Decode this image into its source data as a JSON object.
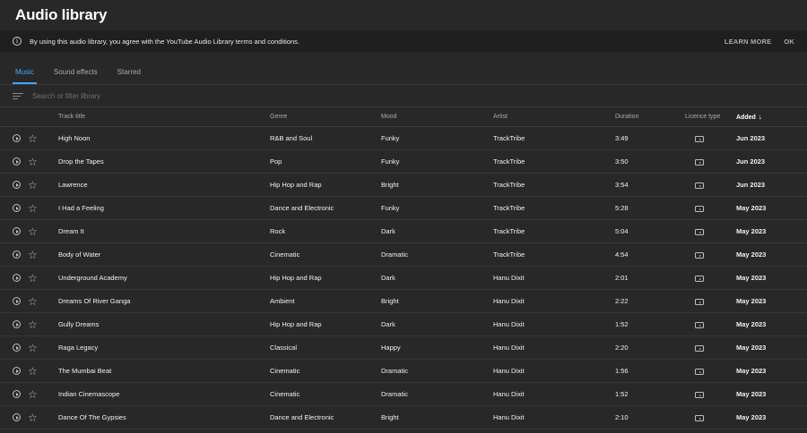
{
  "header": {
    "title": "Audio library"
  },
  "notice": {
    "text": "By using this audio library, you agree with the YouTube Audio Library terms and conditions.",
    "learn_more": "LEARN MORE",
    "ok": "OK"
  },
  "tabs": [
    {
      "label": "Music",
      "active": true
    },
    {
      "label": "Sound effects",
      "active": false
    },
    {
      "label": "Starred",
      "active": false
    }
  ],
  "search": {
    "placeholder": "Search or filter library",
    "value": ""
  },
  "columns": {
    "title": "Track title",
    "genre": "Genre",
    "mood": "Mood",
    "artist": "Artist",
    "duration": "Duration",
    "licence": "Licence type",
    "added": "Added",
    "added_sort_icon": "arrow-down-icon"
  },
  "tracks": [
    {
      "title": "High Noon",
      "genre": "R&B and Soul",
      "mood": "Funky",
      "artist": "TrackTribe",
      "duration": "3:49",
      "added": "Jun 2023"
    },
    {
      "title": "Drop the Tapes",
      "genre": "Pop",
      "mood": "Funky",
      "artist": "TrackTribe",
      "duration": "3:50",
      "added": "Jun 2023"
    },
    {
      "title": "Lawrence",
      "genre": "Hip Hop and Rap",
      "mood": "Bright",
      "artist": "TrackTribe",
      "duration": "3:54",
      "added": "Jun 2023"
    },
    {
      "title": "I Had a Feeling",
      "genre": "Dance and Electronic",
      "mood": "Funky",
      "artist": "TrackTribe",
      "duration": "5:28",
      "added": "May 2023"
    },
    {
      "title": "Dream It",
      "genre": "Rock",
      "mood": "Dark",
      "artist": "TrackTribe",
      "duration": "5:04",
      "added": "May 2023"
    },
    {
      "title": "Body of Water",
      "genre": "Cinematic",
      "mood": "Dramatic",
      "artist": "TrackTribe",
      "duration": "4:54",
      "added": "May 2023"
    },
    {
      "title": "Underground Academy",
      "genre": "Hip Hop and Rap",
      "mood": "Dark",
      "artist": "Hanu Dixit",
      "duration": "2:01",
      "added": "May 2023"
    },
    {
      "title": "Dreams Of River Ganga",
      "genre": "Ambient",
      "mood": "Bright",
      "artist": "Hanu Dixit",
      "duration": "2:22",
      "added": "May 2023"
    },
    {
      "title": "Gully Dreams",
      "genre": "Hip Hop and Rap",
      "mood": "Dark",
      "artist": "Hanu Dixit",
      "duration": "1:52",
      "added": "May 2023"
    },
    {
      "title": "Raga Legacy",
      "genre": "Classical",
      "mood": "Happy",
      "artist": "Hanu Dixit",
      "duration": "2:20",
      "added": "May 2023"
    },
    {
      "title": "The Mumbai Beat",
      "genre": "Cinematic",
      "mood": "Dramatic",
      "artist": "Hanu Dixit",
      "duration": "1:56",
      "added": "May 2023"
    },
    {
      "title": "Indian Cinemascope",
      "genre": "Cinematic",
      "mood": "Dramatic",
      "artist": "Hanu Dixit",
      "duration": "1:52",
      "added": "May 2023"
    },
    {
      "title": "Dance Of The Gypsies",
      "genre": "Dance and Electronic",
      "mood": "Bright",
      "artist": "Hanu Dixit",
      "duration": "2:10",
      "added": "May 2023"
    }
  ],
  "icons": {
    "info": "info-icon",
    "filter": "filter-icon",
    "play": "play-icon",
    "star": "star-icon",
    "licence": "youtube-licence-icon"
  },
  "colors": {
    "background": "#282828",
    "notice_background": "#1f1f1f",
    "accent": "#3ea6ff"
  }
}
